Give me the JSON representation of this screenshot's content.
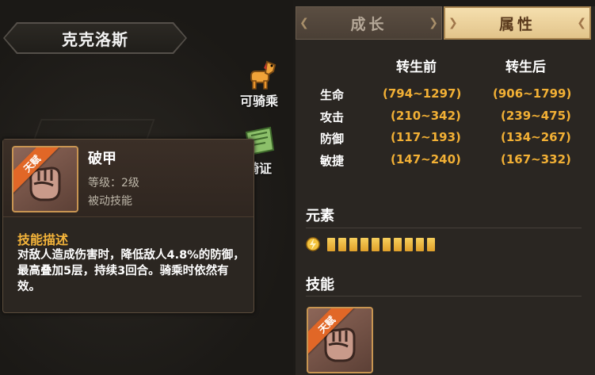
{
  "character": {
    "name": "克克洛斯"
  },
  "side_buttons": {
    "rideable_label": "可骑乘",
    "license_label": "骑证"
  },
  "tooltip": {
    "badge": "天赋",
    "skill_name": "破甲",
    "level": "等级：2级",
    "type": "被动技能",
    "desc_title": "技能描述",
    "desc": "对敌人造成伤害时，降低敌人4.8%的防御，最高叠加5层，持续3回合。骑乘时依然有效。"
  },
  "tabs": [
    {
      "label": "成长",
      "active": false
    },
    {
      "label": "属性",
      "active": true
    }
  ],
  "stats": {
    "col_before": "转生前",
    "col_after": "转生后",
    "rows": [
      {
        "label": "生命",
        "before": "(794~1297)",
        "after": "(906~1799)"
      },
      {
        "label": "攻击",
        "before": "(210~342)",
        "after": "(239~475)"
      },
      {
        "label": "防御",
        "before": "(117~193)",
        "after": "(134~267)"
      },
      {
        "label": "敏捷",
        "before": "(147~240)",
        "after": "(167~332)"
      }
    ]
  },
  "element": {
    "title": "元素",
    "icon": "lightning-element-icon",
    "pips": 10
  },
  "skills": {
    "title": "技能",
    "slot_badge": "天赋"
  },
  "colors": {
    "accent_gold": "#f2b035",
    "tab_active": "#f5dfae",
    "badge_orange": "#e16727"
  }
}
